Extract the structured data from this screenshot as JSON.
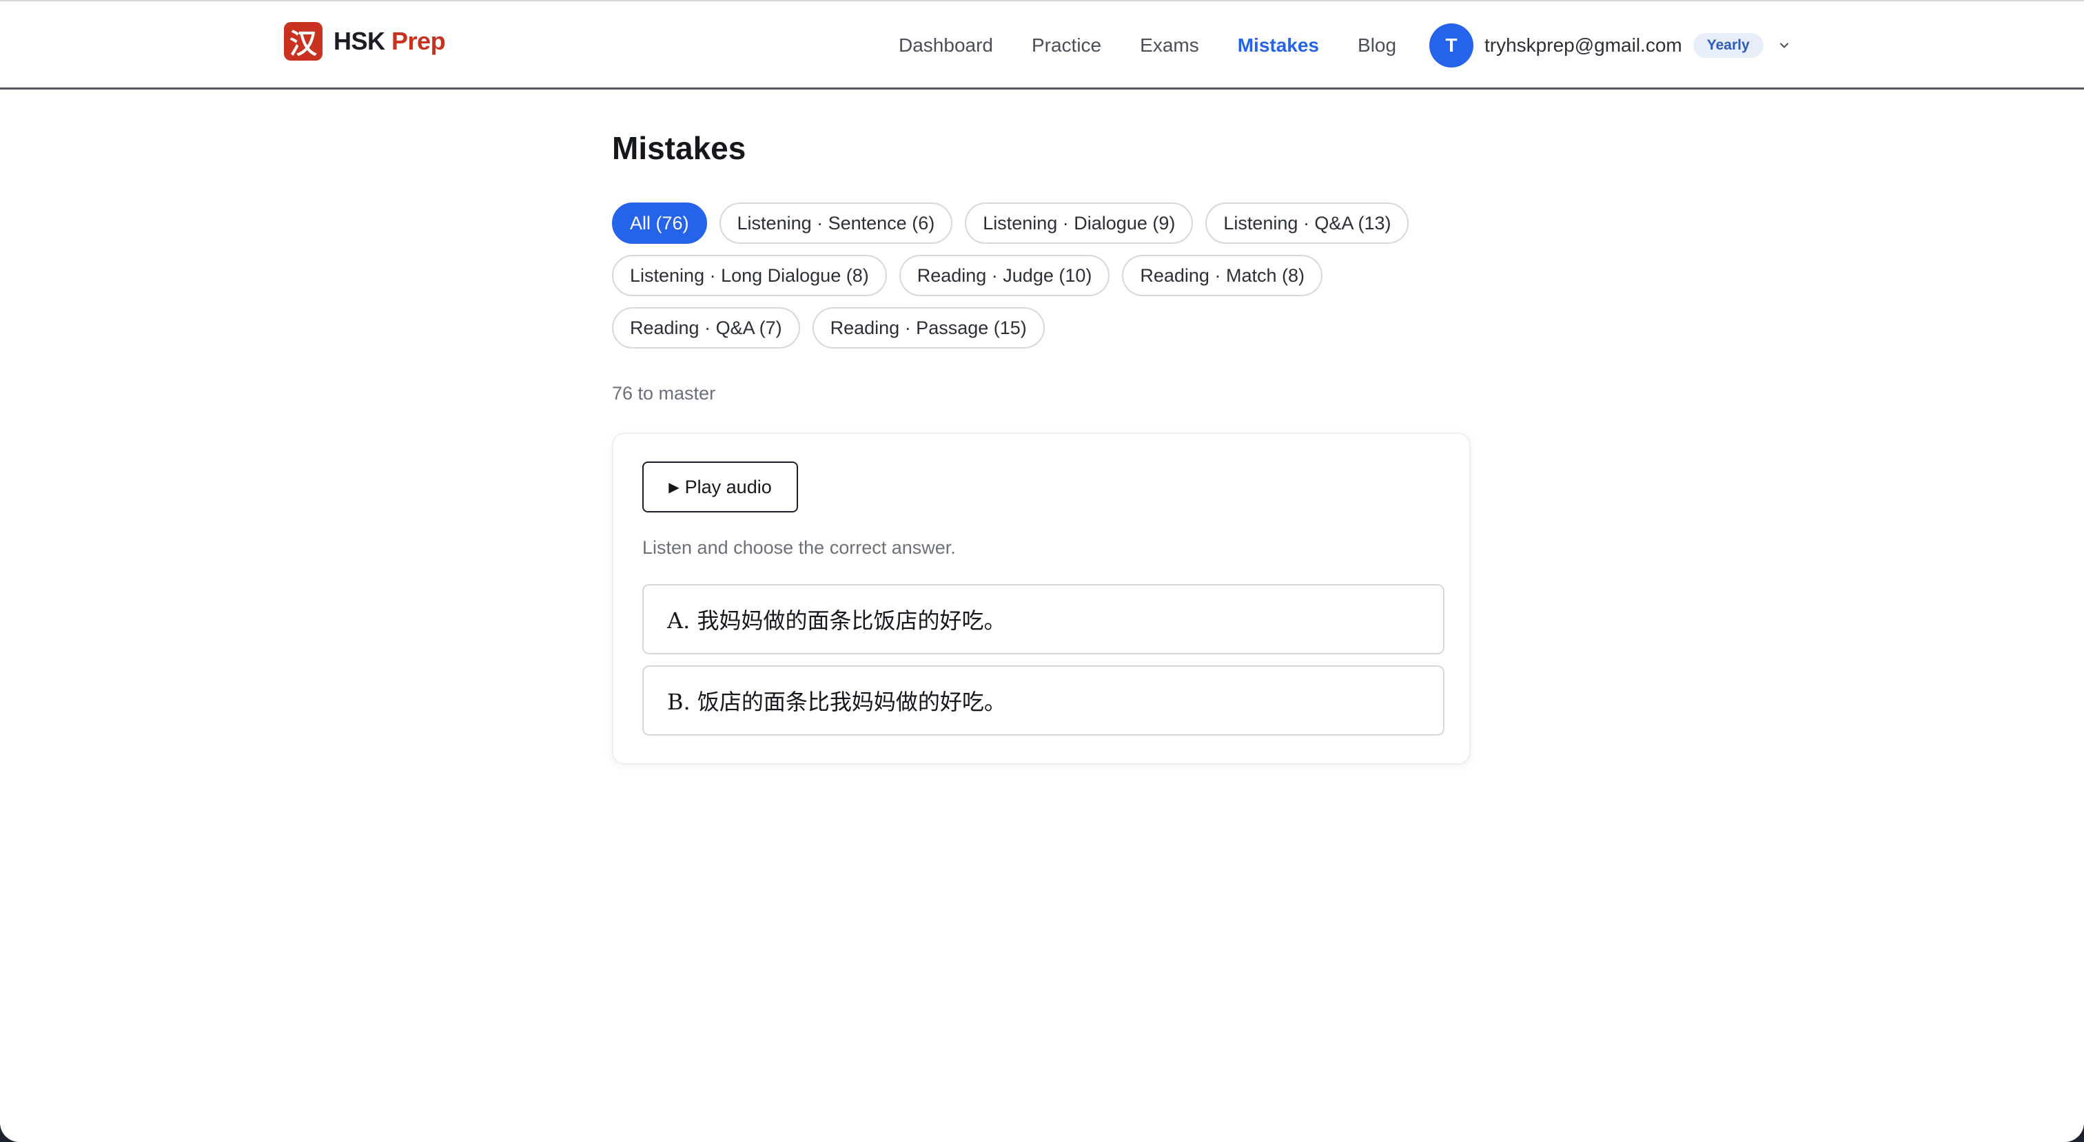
{
  "brand": {
    "glyph": "汉",
    "name": "HSK",
    "name_accent": "Prep",
    "colors": {
      "brand_red": "#c8321f",
      "accent_blue": "#2563eb"
    }
  },
  "nav": {
    "items": [
      {
        "label": "Dashboard",
        "active": false
      },
      {
        "label": "Practice",
        "active": false
      },
      {
        "label": "Exams",
        "active": false
      },
      {
        "label": "Mistakes",
        "active": true
      },
      {
        "label": "Blog",
        "active": false
      }
    ]
  },
  "account": {
    "avatar_initial": "T",
    "email": "tryhskprep@gmail.com",
    "plan": "Yearly",
    "menu_icon": "chevron-down-icon"
  },
  "page": {
    "title": "Mistakes",
    "filters": [
      {
        "label": "All (76)",
        "active": true
      },
      {
        "label": "Listening · Sentence (6)",
        "active": false
      },
      {
        "label": "Listening · Dialogue (9)",
        "active": false
      },
      {
        "label": "Listening · Q&A (13)",
        "active": false
      },
      {
        "label": "Listening · Long Dialogue (8)",
        "active": false
      },
      {
        "label": "Reading · Judge (10)",
        "active": false
      },
      {
        "label": "Reading · Match (8)",
        "active": false
      },
      {
        "label": "Reading · Q&A (7)",
        "active": false
      },
      {
        "label": "Reading · Passage (15)",
        "active": false
      }
    ],
    "count_note": "76 to master"
  },
  "question": {
    "play_glyph": "▶",
    "play_label": "Play audio",
    "instruction": "Listen and choose the correct answer.",
    "options": [
      {
        "label": "A. 我妈妈做的面条比饭店的好吃。"
      },
      {
        "label": "B. 饭店的面条比我妈妈做的好吃。"
      }
    ]
  }
}
